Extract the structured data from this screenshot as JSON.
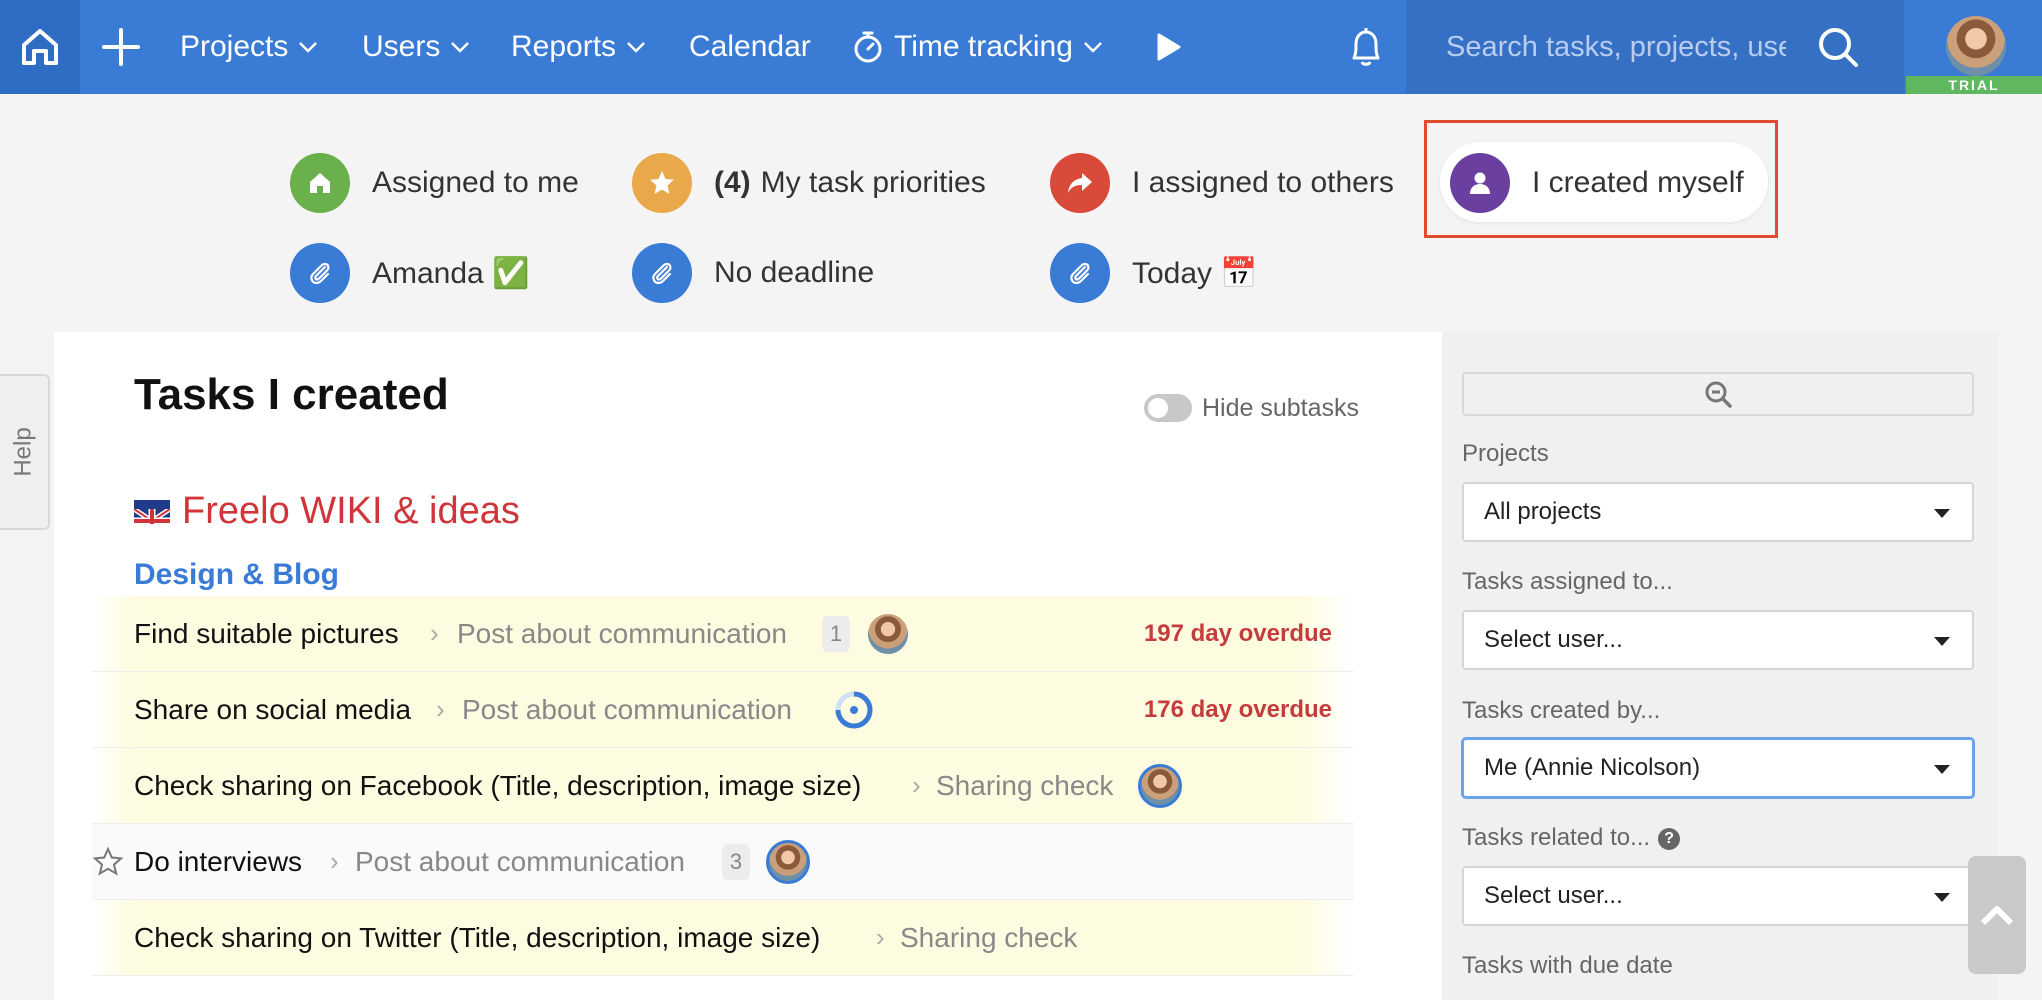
{
  "nav": {
    "items": [
      {
        "label": "Projects"
      },
      {
        "label": "Users"
      },
      {
        "label": "Reports"
      },
      {
        "label": "Calendar"
      },
      {
        "label": "Time tracking"
      }
    ],
    "search_placeholder": "Search tasks, projects, users...",
    "trial_badge": "TRIAL",
    "bar_color": "#3a7bd5"
  },
  "filters": {
    "assigned_to_me": "Assigned to me",
    "priorities_count": "(4)",
    "priorities_label": "My task priorities",
    "assigned_to_others": "I assigned to others",
    "created_myself": "I created myself",
    "amanda": "Amanda ✅",
    "no_deadline": "No deadline",
    "today": "Today 📅"
  },
  "help_tab": "Help",
  "main": {
    "title": "Tasks I created",
    "hide_subtasks": "Hide subtasks",
    "project": "Freelo WIKI & ideas",
    "group": "Design & Blog",
    "tasks": [
      {
        "name": "Find suitable pictures",
        "parent": "Post about communication",
        "count": "1",
        "overdue": "197 day overdue"
      },
      {
        "name": "Share on social media",
        "parent": "Post about communication",
        "overdue": "176 day overdue"
      },
      {
        "name": "Check sharing on Facebook (Title, description, image size)",
        "parent": "Sharing check"
      },
      {
        "name": "Do interviews",
        "parent": "Post about communication",
        "count": "3"
      },
      {
        "name": "Check sharing on Twitter (Title, description, image size)",
        "parent": "Sharing check"
      }
    ]
  },
  "sidebar": {
    "projects_label": "Projects",
    "projects_value": "All projects",
    "assigned_label": "Tasks assigned to...",
    "assigned_value": "Select user...",
    "created_label": "Tasks created by...",
    "created_value": "Me (Annie Nicolson)",
    "related_label": "Tasks related to...",
    "related_value": "Select user...",
    "due_label": "Tasks with due date"
  },
  "colors": {
    "accent": "#3a7bd5",
    "overdue": "#c43c3c",
    "project": "#d0353a",
    "chip_green": "#6ab04c",
    "chip_orange": "#e9a94b",
    "chip_red": "#d94a3a",
    "chip_purple": "#6a3fa0",
    "chip_blue": "#3a7bd5",
    "highlight_border": "#e14a2c"
  }
}
